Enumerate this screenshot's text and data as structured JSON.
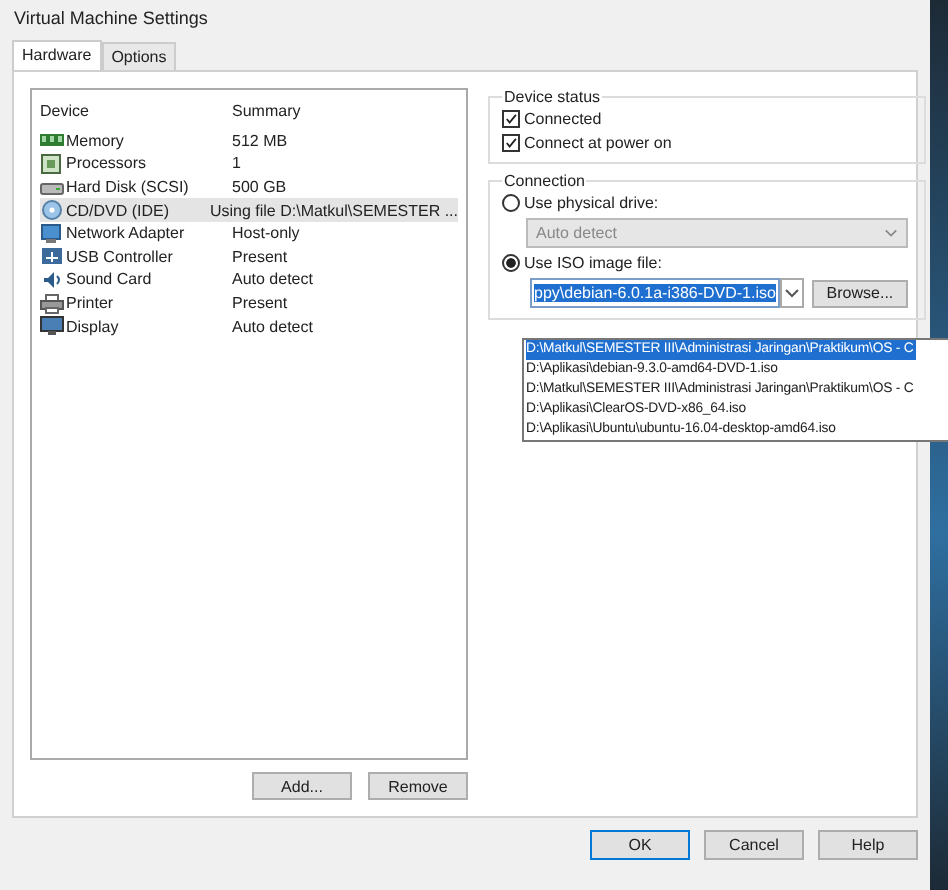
{
  "window": {
    "title": "Virtual Machine Settings"
  },
  "tabs": [
    {
      "label": "Hardware",
      "selected": true
    },
    {
      "label": "Options",
      "selected": false
    }
  ],
  "devices": {
    "columns": [
      "Device",
      "Summary"
    ],
    "rows": [
      {
        "kind": "memory",
        "device": "Memory",
        "summary": "512 MB",
        "selected": false
      },
      {
        "kind": "processor",
        "device": "Processors",
        "summary": "1",
        "selected": false
      },
      {
        "kind": "disk",
        "device": "Hard Disk (SCSI)",
        "summary": "500 GB",
        "selected": false
      },
      {
        "kind": "cd",
        "device": "CD/DVD (IDE)",
        "summary": "Using file D:\\Matkul\\SEMESTER ...",
        "selected": true
      },
      {
        "kind": "network",
        "device": "Network Adapter",
        "summary": "Host-only",
        "selected": false
      },
      {
        "kind": "usb",
        "device": "USB Controller",
        "summary": "Present",
        "selected": false
      },
      {
        "kind": "sound",
        "device": "Sound Card",
        "summary": "Auto detect",
        "selected": false
      },
      {
        "kind": "printer",
        "device": "Printer",
        "summary": "Present",
        "selected": false
      },
      {
        "kind": "display",
        "device": "Display",
        "summary": "Auto detect",
        "selected": false
      }
    ]
  },
  "device_buttons": [
    "Add...",
    "Remove"
  ],
  "device_status": {
    "title": "Device status",
    "options": [
      {
        "label": "Connected",
        "checked": true
      },
      {
        "label": "Connect at power on",
        "checked": true
      }
    ]
  },
  "connection": {
    "title": "Connection",
    "options": [
      {
        "label": "Use physical drive:",
        "selected": false
      },
      {
        "label": "Use ISO image file:",
        "selected": true
      }
    ],
    "physical_drive": {
      "value": "Auto detect",
      "disabled": true
    },
    "iso_file": {
      "value": "ppy\\debian-6.0.1a-i386-DVD-1.iso",
      "browse": "Browse...",
      "list": [
        {
          "text": "D:\\Matkul\\SEMESTER III\\Administrasi Jaringan\\Praktikum\\OS - C",
          "selected": true
        },
        {
          "text": "D:\\Aplikasi\\debian-9.3.0-amd64-DVD-1.iso",
          "selected": false
        },
        {
          "text": "D:\\Matkul\\SEMESTER III\\Administrasi Jaringan\\Praktikum\\OS - C",
          "selected": false
        },
        {
          "text": "D:\\Aplikasi\\ClearOS-DVD-x86_64.iso",
          "selected": false
        },
        {
          "text": "D:\\Aplikasi\\Ubuntu\\ubuntu-16.04-desktop-amd64.iso",
          "selected": false
        }
      ]
    }
  },
  "buttons": [
    "OK",
    "Cancel",
    "Help"
  ]
}
